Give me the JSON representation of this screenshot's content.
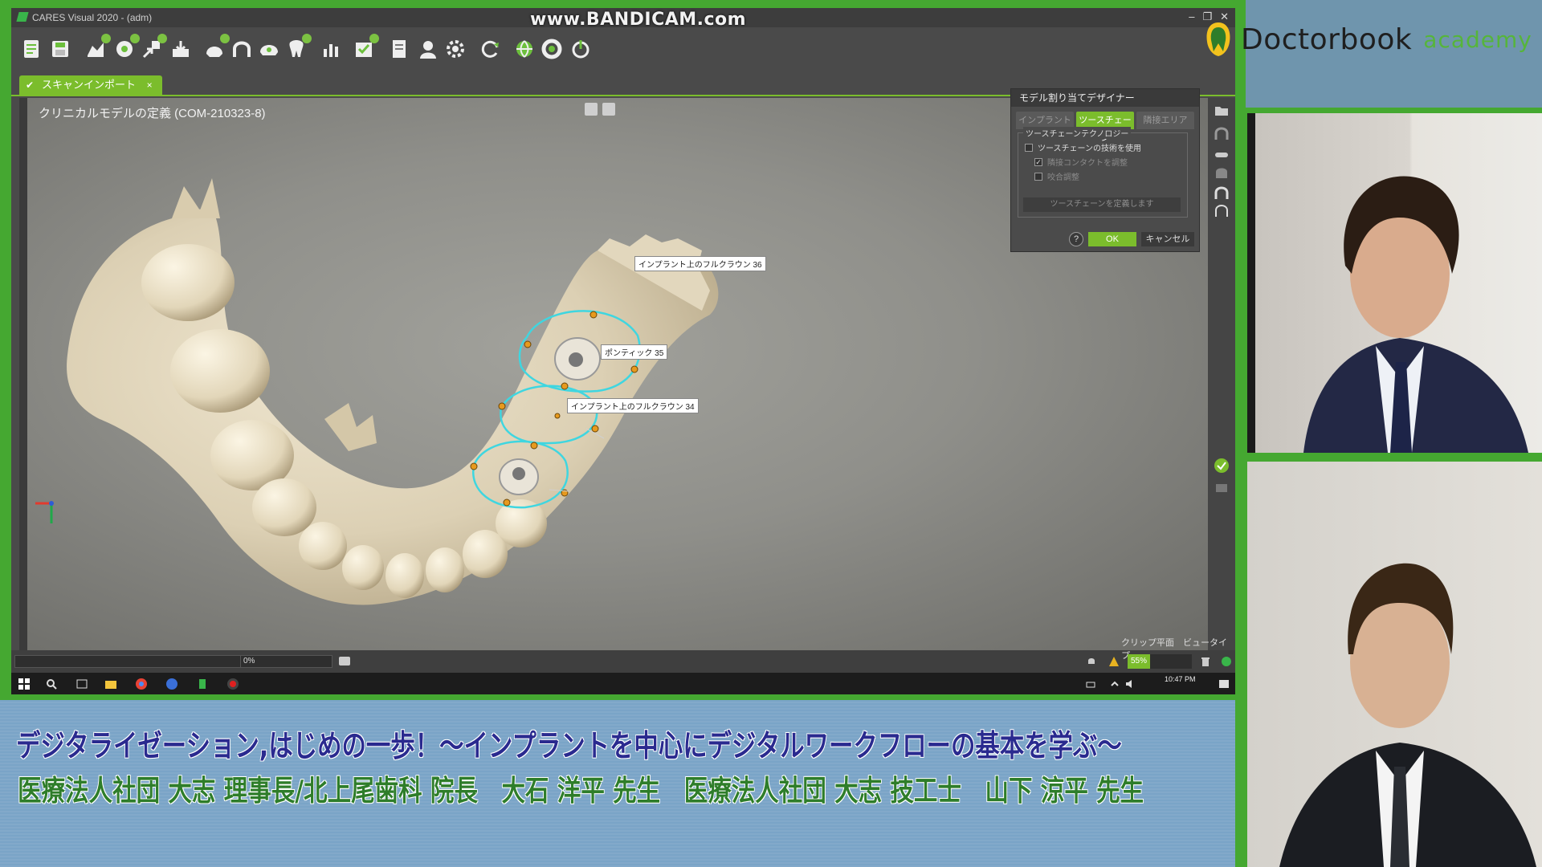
{
  "app": {
    "window_title": "CARES Visual 2020 - (adm)",
    "recorder_watermark": "www.BANDICAM.com",
    "tab_label": "スキャンインポート",
    "model_title": "クリニカルモデルの定義 (COM-210323-8)"
  },
  "toolbar": {
    "icons": [
      "new-order-icon",
      "save-icon",
      "scan-import-icon",
      "library-icon",
      "export-icon",
      "import-icon",
      "model-icon",
      "arch-icon",
      "jaw-icon",
      "tooth-icon",
      "chart-icon",
      "check-order-icon",
      "report-icon",
      "user-icon",
      "settings-icon",
      "refresh-icon",
      "globe-icon",
      "support-icon",
      "power-icon"
    ]
  },
  "callouts": {
    "implant_36": "インプラント上のフルクラウン 36",
    "pontic_35": "ポンティック 35",
    "implant_34": "インプラント上のフルクラウン 34"
  },
  "designer": {
    "title": "モデル割り当てデザイナー",
    "tabs": [
      "インプラント",
      "ツースチェーン",
      "隣接エリア"
    ],
    "group_label": "ツースチェーンテクノロジー",
    "opt_use": "ツースチェーンの技術を使用",
    "opt_adjust_length": "隣接コンタクトを調整",
    "opt_adjust_occlusion": "咬合調整",
    "define_button": "ツースチェーンを定義します",
    "help": "?",
    "ok": "OK",
    "cancel": "キャンセル"
  },
  "status": {
    "progress_percent": "0%",
    "clip_view": "クリップ平面　ビュータイプ",
    "zoom": "55%",
    "clock_time": "10:47 PM"
  },
  "brand": {
    "name": "Doctorbook",
    "suffix": "academy"
  },
  "subtitle": {
    "line1": "デジタライゼーション,はじめの一歩！～インプラントを中心にデジタルワークフローの基本を学ぶ～",
    "line2": "医療法人社団 大志 理事長/北上尾歯科 院長　大石 洋平 先生　医療法人社団 大志 技工士　山下 涼平 先生"
  }
}
